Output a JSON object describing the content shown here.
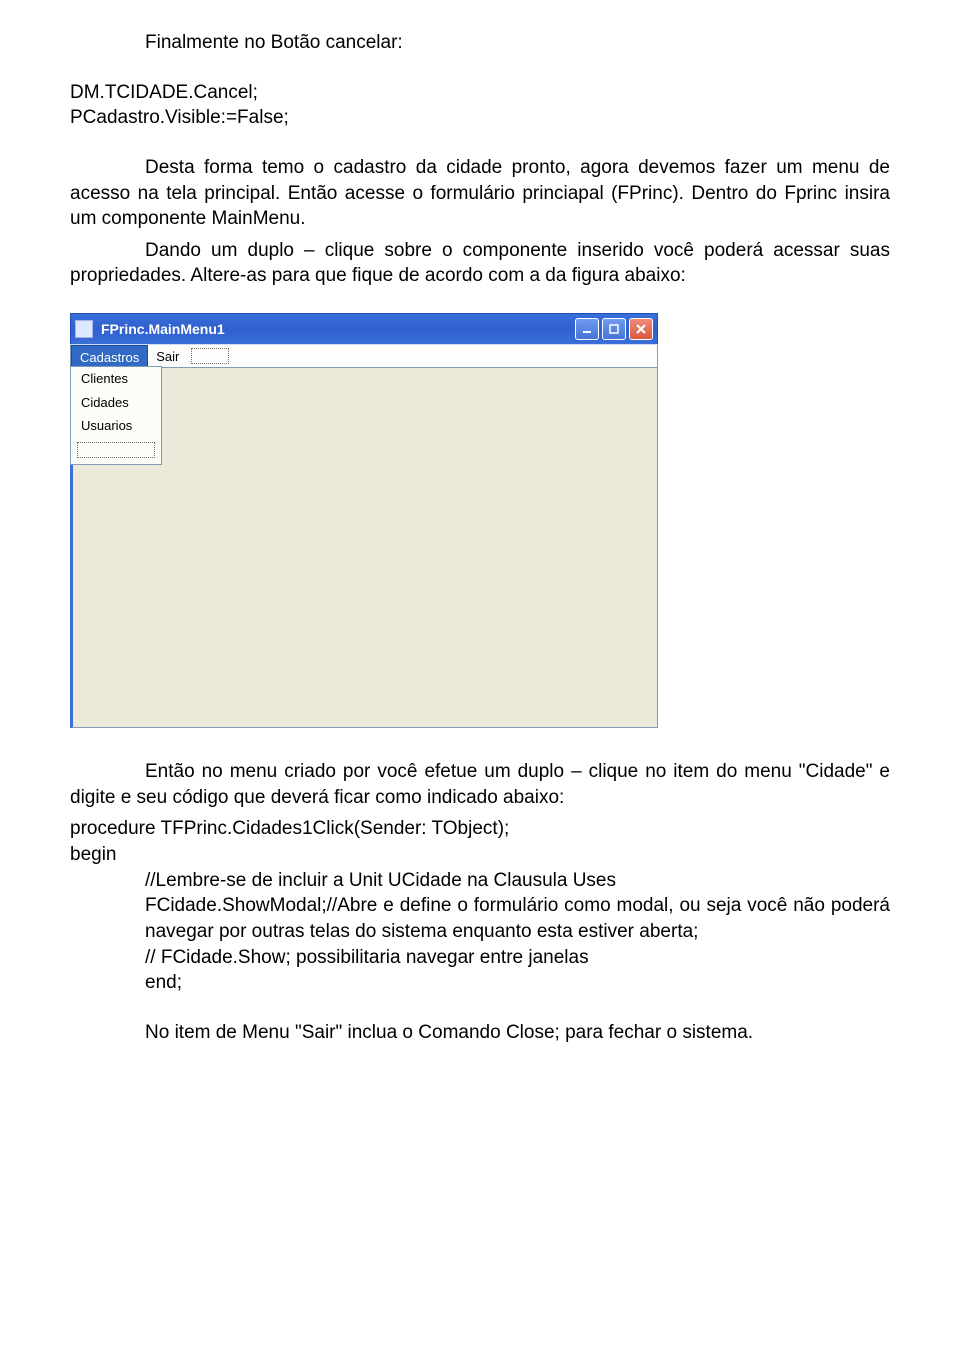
{
  "para1_line1": "Finalmente no Botão cancelar:",
  "code1": {
    "l1": "DM.TCIDADE.Cancel;",
    "l2": "PCadastro.Visible:=False;"
  },
  "para2": "Desta forma temo o cadastro da cidade pronto, agora devemos fazer um menu de acesso na tela principal. Então acesse o formulário princiapal (FPrinc). Dentro do Fprinc insira um componente MainMenu.",
  "para3": "Dando um duplo – clique sobre o componente inserido você poderá acessar suas propriedades. Altere-as para que fique de acordo com a da figura abaixo:",
  "screenshot": {
    "title": "FPrinc.MainMenu1",
    "menu_items": [
      "Cadastros",
      "Sair"
    ],
    "dropdown_items": [
      "Clientes",
      "Cidades",
      "Usuarios"
    ]
  },
  "para4": "Então no menu criado por você efetue um duplo – clique no item do menu \"Cidade\" e digite e seu código que deverá ficar como indicado abaixo:",
  "code2": {
    "l1": "procedure TFPrinc.Cidades1Click(Sender: TObject);",
    "l2": "begin",
    "l3": "//Lembre-se de incluir a Unit UCidade na Clausula Uses",
    "l4": "FCidade.ShowModal;//Abre e define o formulário como modal, ou seja você não poderá navegar por outras telas do sistema enquanto esta estiver aberta;",
    "l5": "// FCidade.Show; possibilitaria navegar entre janelas",
    "l6": "end;"
  },
  "para5": "No item de Menu \"Sair\" inclua o Comando Close; para fechar o sistema."
}
